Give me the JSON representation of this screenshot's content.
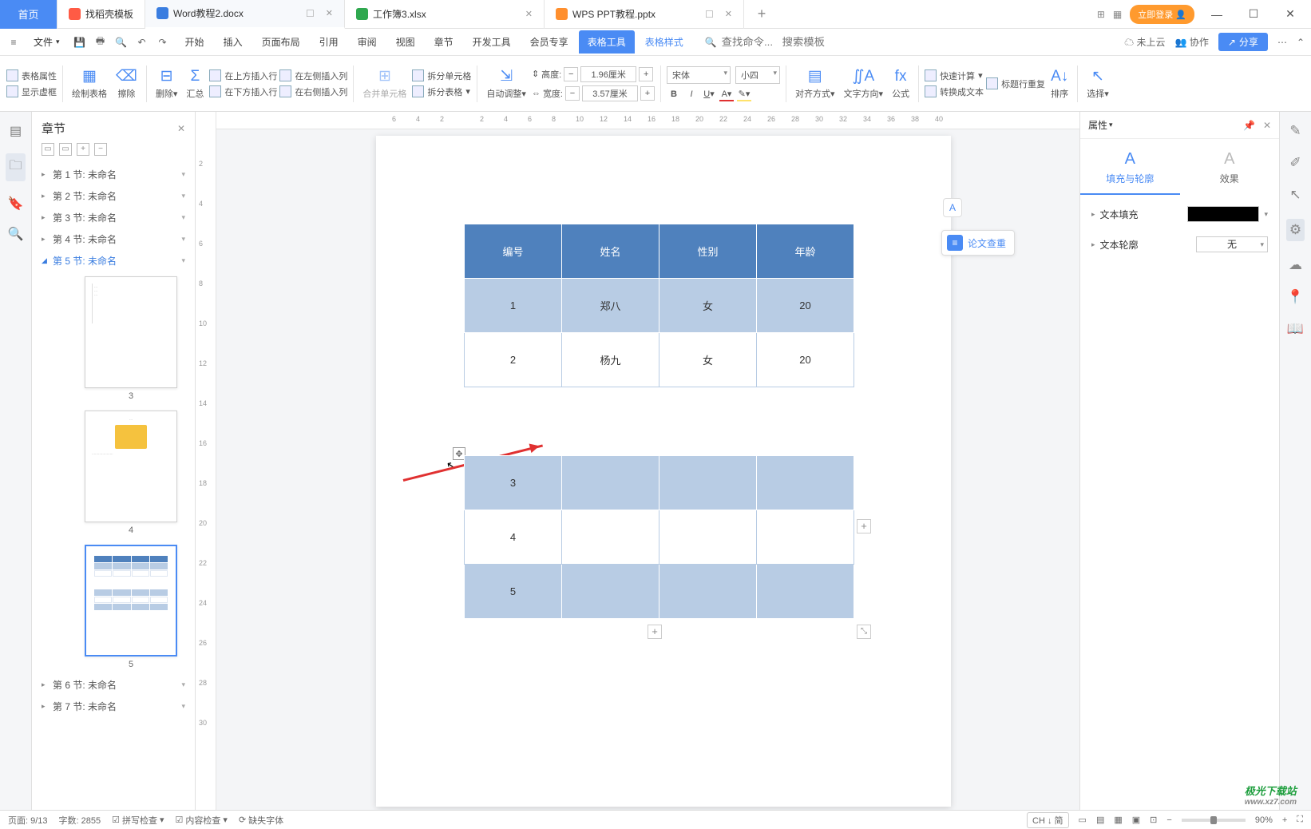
{
  "titlebar": {
    "home": "首页",
    "tabs": [
      {
        "label": "找稻壳模板",
        "color": "#ff5b45"
      },
      {
        "label": "Word教程2.docx",
        "color": "#3a7de0",
        "active": true
      },
      {
        "label": "工作簿3.xlsx",
        "color": "#2fa84f"
      },
      {
        "label": "WPS PPT教程.pptx",
        "color": "#ff8f2e"
      }
    ],
    "login": "立即登录"
  },
  "menubar": {
    "file": "文件",
    "tabs": [
      "开始",
      "插入",
      "页面布局",
      "引用",
      "审阅",
      "视图",
      "章节",
      "开发工具",
      "会员专享"
    ],
    "tabActive": "表格工具",
    "tabLink": "表格样式",
    "searchCmd": "查找命令...",
    "searchTpl": "搜索模板",
    "cloud": "未上云",
    "collab": "协作",
    "share": "分享"
  },
  "ribbon": {
    "g1a": "表格属性",
    "g1b": "显示虚框",
    "g2": "绘制表格",
    "g3": "擦除",
    "g4": "删除",
    "g5": "汇总",
    "g6a": "在上方插入行",
    "g6b": "在下方插入行",
    "g7a": "在左侧插入列",
    "g7b": "在右侧插入列",
    "g8": "合并单元格",
    "g9a": "拆分单元格",
    "g9b": "拆分表格",
    "g10": "自动调整",
    "h": "高度:",
    "hval": "1.96厘米",
    "w": "宽度:",
    "wval": "3.57厘米",
    "font": "宋体",
    "size": "小四",
    "align": "对齐方式",
    "dir": "文字方向",
    "fx": "公式",
    "calc": "快速计算",
    "repeat": "标题行重复",
    "totext": "转换成文本",
    "sort": "排序",
    "select": "选择"
  },
  "nav": {
    "title": "章节",
    "items": [
      {
        "label": "第 1 节: 未命名"
      },
      {
        "label": "第 2 节: 未命名"
      },
      {
        "label": "第 3 节: 未命名"
      },
      {
        "label": "第 4 节: 未命名"
      },
      {
        "label": "第 5 节: 未命名",
        "active": true
      },
      {
        "label": "第 6 节: 未命名"
      },
      {
        "label": "第 7 节: 未命名"
      }
    ],
    "thumbs": [
      "3",
      "4",
      "5"
    ]
  },
  "doc": {
    "table1": {
      "head": [
        "编号",
        "姓名",
        "性别",
        "年龄"
      ],
      "rows": [
        [
          "1",
          "郑八",
          "女",
          "20"
        ],
        [
          "2",
          "杨九",
          "女",
          "20"
        ]
      ]
    },
    "table2": {
      "rows": [
        [
          "3",
          "",
          "",
          ""
        ],
        [
          "4",
          "",
          "",
          ""
        ],
        [
          "5",
          "",
          "",
          ""
        ]
      ]
    },
    "floatA": "A",
    "paperCheck": "论文查重"
  },
  "props": {
    "title": "属性",
    "tab1": "填充与轮廓",
    "tab2": "效果",
    "fill": "文本填充",
    "outline": "文本轮廓",
    "outlineVal": "无"
  },
  "status": {
    "page": "页面: 9/13",
    "words": "字数: 2855",
    "spell": "拼写检查",
    "content": "内容检查",
    "missfont": "缺失字体",
    "ime": "CH ↓ 简",
    "zoom": "90%"
  },
  "watermark": {
    "main": "极光下载站",
    "sub": "www.xz7.com"
  }
}
